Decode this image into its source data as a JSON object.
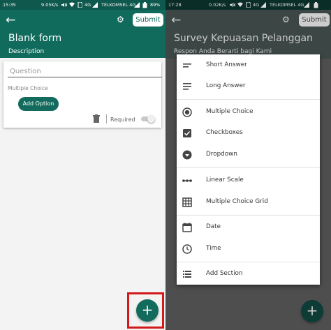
{
  "left": {
    "status": {
      "time": "15:35",
      "speed": "9.05K/s",
      "network": "4G",
      "carrier": "TELKOMSEL 4G",
      "battery": "89%"
    },
    "appbar": {
      "submit_label": "Submit",
      "title": "Blank form",
      "description": "Description"
    },
    "question_card": {
      "placeholder": "Question",
      "type_label": "Multiple Choice",
      "add_option_label": "Add Option",
      "required_label": "Required",
      "required_on": false
    },
    "fab_label": "+"
  },
  "right": {
    "status": {
      "time": "17:28",
      "speed": "0.02K/s",
      "network": "4G",
      "carrier": "TELKOMSEL 4G",
      "battery": ""
    },
    "appbar": {
      "submit_label": "Submit",
      "title": "Survey Kepuasan Pelanggan",
      "description": "Respon Anda Berarti bagi Kami"
    },
    "fab_label": "+",
    "menu": {
      "items": [
        {
          "label": "Short Answer",
          "icon": "short-answer-icon"
        },
        {
          "label": "Long Answer",
          "icon": "long-answer-icon"
        },
        {
          "label": "Multiple Choice",
          "icon": "radio-button-icon"
        },
        {
          "label": "Checkboxes",
          "icon": "checkbox-icon"
        },
        {
          "label": "Dropdown",
          "icon": "dropdown-icon"
        },
        {
          "label": "Linear Scale",
          "icon": "linear-scale-icon"
        },
        {
          "label": "Multiple Choice Grid",
          "icon": "grid-icon"
        },
        {
          "label": "Date",
          "icon": "calendar-icon"
        },
        {
          "label": "Time",
          "icon": "clock-icon"
        },
        {
          "label": "Add Section",
          "icon": "add-section-icon"
        }
      ]
    }
  },
  "colors": {
    "primary": "#126b5c",
    "primary_dark": "#0f584d",
    "highlight": "#d21818"
  }
}
